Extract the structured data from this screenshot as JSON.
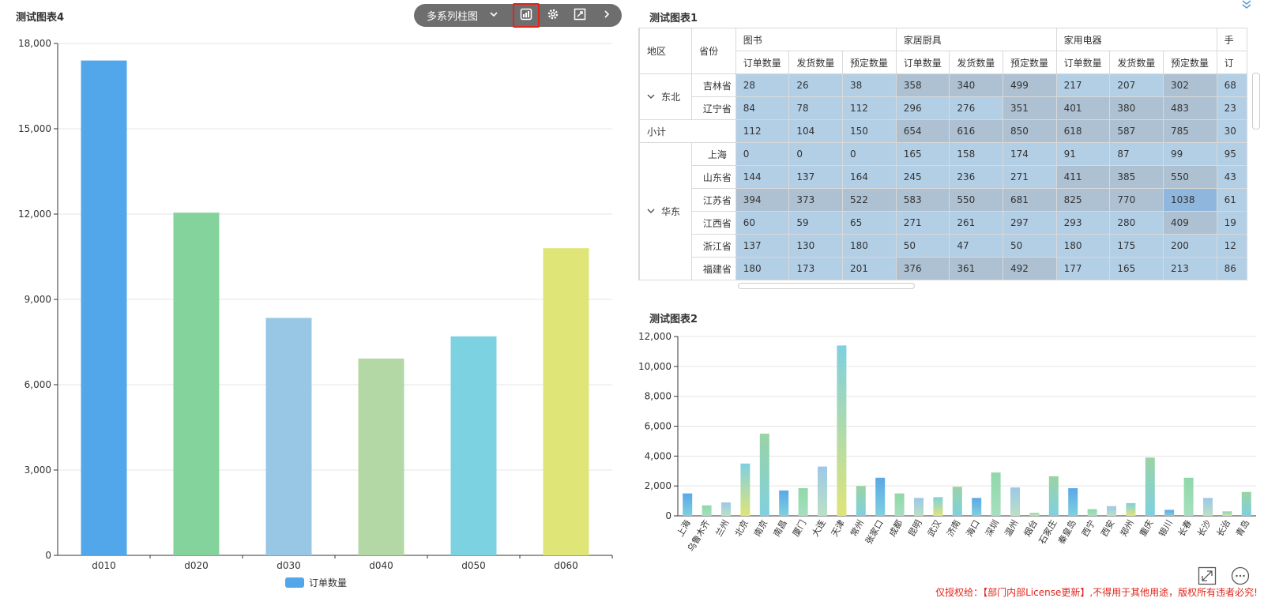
{
  "chart4": {
    "title": "测试图表4",
    "toolbar": {
      "chart_type": "多系列柱图",
      "icons": [
        "chevron-down-icon",
        "chart-switch-icon",
        "gear-icon",
        "expand-icon",
        "chevron-right-icon"
      ]
    },
    "legend_label": "订单数量",
    "colors": [
      "#52a7ea",
      "#84d29c",
      "#98c7e6",
      "#b4d7a6",
      "#7dd2e2",
      "#dfe577"
    ]
  },
  "table1": {
    "title": "测试图表1",
    "header": {
      "region": "地区",
      "province": "省份",
      "groups": [
        "图书",
        "家居厨具",
        "家用电器",
        "手"
      ],
      "measures": [
        "订单数量",
        "发货数量",
        "预定数量",
        "订"
      ]
    },
    "subtotal_label": "小计",
    "regions": [
      {
        "name": "东北",
        "rows": [
          {
            "province": "吉林省",
            "values": [
              "28",
              "26",
              "38",
              "358",
              "340",
              "499",
              "217",
              "207",
              "302",
              "68"
            ]
          },
          {
            "province": "辽宁省",
            "values": [
              "84",
              "78",
              "112",
              "296",
              "276",
              "351",
              "401",
              "380",
              "483",
              "23"
            ]
          }
        ],
        "subtotal": [
          "112",
          "104",
          "150",
          "654",
          "616",
          "850",
          "618",
          "587",
          "785",
          "30"
        ]
      },
      {
        "name": "华东",
        "rows": [
          {
            "province": "上海",
            "values": [
              "0",
              "0",
              "0",
              "165",
              "158",
              "174",
              "91",
              "87",
              "99",
              "95"
            ]
          },
          {
            "province": "山东省",
            "values": [
              "144",
              "137",
              "164",
              "245",
              "236",
              "271",
              "411",
              "385",
              "550",
              "43"
            ]
          },
          {
            "province": "江苏省",
            "values": [
              "394",
              "373",
              "522",
              "583",
              "550",
              "681",
              "825",
              "770",
              "1038",
              "61"
            ]
          },
          {
            "province": "江西省",
            "values": [
              "60",
              "59",
              "65",
              "271",
              "261",
              "297",
              "293",
              "280",
              "409",
              "19"
            ]
          },
          {
            "province": "浙江省",
            "values": [
              "137",
              "130",
              "180",
              "50",
              "47",
              "50",
              "180",
              "175",
              "200",
              "12"
            ]
          },
          {
            "province": "福建省",
            "values": [
              "180",
              "173",
              "201",
              "376",
              "361",
              "492",
              "177",
              "165",
              "213",
              "86"
            ]
          }
        ]
      }
    ]
  },
  "chart2": {
    "title": "测试图表2"
  },
  "footer": {
    "license_text": "仅授权给：【部门内部License更新】,不得用于其他用途，版权所有违者必究!",
    "icons": [
      "expand-icon",
      "more-icon"
    ]
  },
  "chart_data": [
    {
      "type": "bar",
      "title": "测试图表4",
      "categories": [
        "d010",
        "d020",
        "d030",
        "d040",
        "d050",
        "d060"
      ],
      "series": [
        {
          "name": "订单数量",
          "values": [
            17400,
            12050,
            8350,
            6920,
            7700,
            10800
          ]
        }
      ],
      "ylim": [
        0,
        18000
      ],
      "yticks": [
        "0",
        "3,000",
        "6,000",
        "9,000",
        "12,000",
        "15,000",
        "18,000"
      ],
      "legend": "bottom",
      "grid": true
    },
    {
      "type": "bar",
      "title": "测试图表2",
      "categories": [
        "上海",
        "乌鲁木齐",
        "兰州",
        "北京",
        "南京",
        "南昌",
        "厦门",
        "大连",
        "天津",
        "常州",
        "张家口",
        "成都",
        "昆明",
        "武汉",
        "济南",
        "海口",
        "深圳",
        "温州",
        "烟台",
        "石家庄",
        "秦皇岛",
        "西宁",
        "西安",
        "郑州",
        "重庆",
        "银川",
        "长春",
        "长沙",
        "长治",
        "青岛"
      ],
      "values": [
        1500,
        700,
        900,
        3500,
        5500,
        1700,
        1850,
        3300,
        11400,
        2000,
        2550,
        1500,
        1200,
        1250,
        1950,
        1200,
        2900,
        1900,
        200,
        2650,
        1850,
        450,
        650,
        850,
        3900,
        400,
        2550,
        1200,
        300,
        1600
      ],
      "ylim": [
        0,
        12000
      ],
      "yticks": [
        "0",
        "2,000",
        "4,000",
        "6,000",
        "8,000",
        "10,000",
        "12,000"
      ],
      "grid": true
    }
  ]
}
